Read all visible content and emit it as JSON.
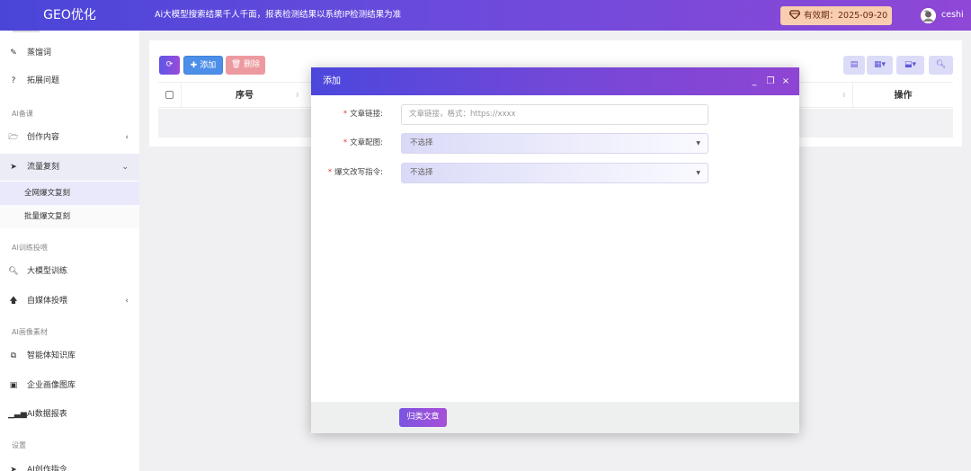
{
  "header": {
    "logo": "GEO优化",
    "tagline": "Ai大模型搜索结果千人千面，报表检测结果以系统IP检测结果为准",
    "validity": "有效期：2025-09-20",
    "username": "ceshi"
  },
  "sidebar": {
    "items": [
      {
        "label": "蒸馏词",
        "icon": "pencil-icon"
      },
      {
        "label": "拓展问题",
        "icon": "question-icon"
      },
      {
        "group": "AI备课"
      },
      {
        "label": "创作内容",
        "icon": "folder-icon",
        "arrow": "‹"
      },
      {
        "label": "流量复刻",
        "icon": "send-icon",
        "arrow": "⌄"
      },
      {
        "label": "全网爆文复刻"
      },
      {
        "label": "批量爆文复刻"
      },
      {
        "group": "AI训练投喂"
      },
      {
        "label": "大模型训练",
        "icon": "search-icon"
      },
      {
        "label": "自媒体投喂",
        "icon": "arrow-up-icon",
        "arrow": "‹"
      },
      {
        "group": "AI画像素材"
      },
      {
        "label": "智能体知识库",
        "icon": "copy-icon"
      },
      {
        "label": "企业画像图库",
        "icon": "image-icon"
      },
      {
        "label": "AI数据报表",
        "icon": "bar-chart-icon"
      },
      {
        "group": "设置"
      },
      {
        "label": "AI创作指令",
        "icon": "send-icon"
      }
    ]
  },
  "toolbar": {
    "add_label": "✚ 添加",
    "delete_label": "🗑 删除"
  },
  "table": {
    "col_index": "序号",
    "col_ops": "操作"
  },
  "modal": {
    "title": "添加",
    "fields": [
      {
        "label": "文章链接:",
        "placeholder": "文章链接，格式：https://xxxx"
      },
      {
        "label": "文章配图:",
        "value": "不选择"
      },
      {
        "label": "爆文改写指令:",
        "value": "不选择"
      }
    ],
    "submit_label": "归类文章"
  },
  "colors": {
    "header_gradient_start": "#4a45d8",
    "header_gradient_end": "#8f47d6",
    "validity_bg": "#f8cdb0",
    "add_button": "#4d8fe8",
    "delete_button": "#ec9aa0"
  }
}
